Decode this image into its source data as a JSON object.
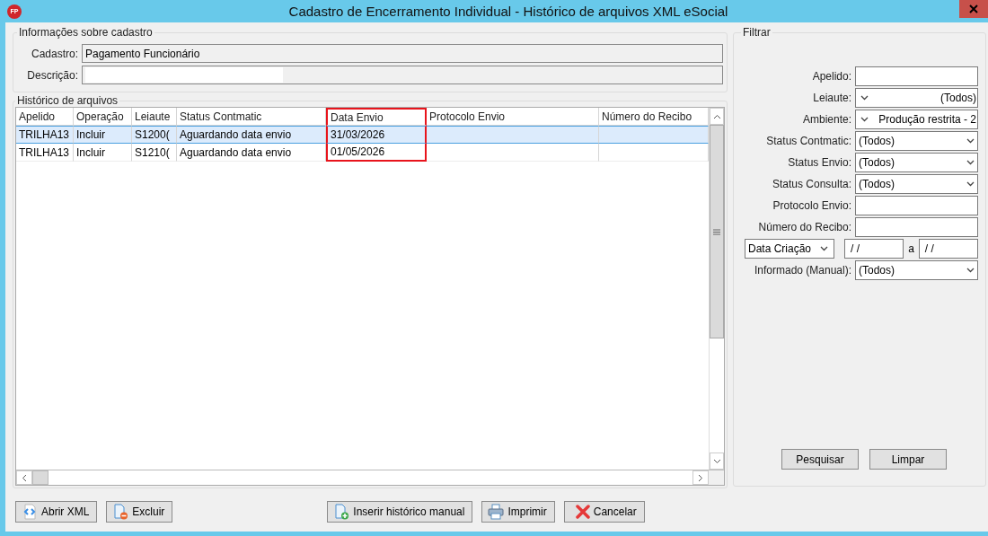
{
  "window": {
    "title": "Cadastro de Encerramento Individual - Histórico de arquivos XML eSocial",
    "app_icon_text": "FP"
  },
  "info": {
    "title": "Informações sobre cadastro",
    "fields": [
      {
        "label": "Cadastro:",
        "value": "Pagamento Funcionário"
      },
      {
        "label": "Descrição:",
        "masked": true
      }
    ]
  },
  "history": {
    "title": "Histórico de arquivos",
    "columns": [
      {
        "label": "Apelido",
        "highlighted": false
      },
      {
        "label": "Operação",
        "highlighted": false
      },
      {
        "label": "Leiaute",
        "highlighted": false
      },
      {
        "label": "Status Contmatic",
        "highlighted": false
      },
      {
        "label": "Data Envio",
        "highlighted": true
      },
      {
        "label": "Protocolo Envio",
        "highlighted": false
      },
      {
        "label": "Número do Recibo",
        "highlighted": false
      }
    ],
    "rows": [
      {
        "selected": true,
        "cells": [
          "TRILHA13",
          "Incluir",
          "S1200(",
          "Aguardando data envio",
          "31/03/2026",
          "",
          ""
        ]
      },
      {
        "selected": false,
        "cells": [
          "TRILHA13",
          "Incluir",
          "S1210(",
          "Aguardando data envio",
          "01/05/2026",
          "",
          ""
        ]
      }
    ]
  },
  "filter": {
    "title": "Filtrar",
    "fields": [
      {
        "kind": "text",
        "label": "Apelido:"
      },
      {
        "kind": "select-left",
        "label": "Leiaute:",
        "value": "(Todos)"
      },
      {
        "kind": "select-left",
        "label": "Ambiente:",
        "value": "Produção restrita - 2"
      },
      {
        "kind": "select",
        "label": "Status Contmatic:",
        "value": "(Todos)"
      },
      {
        "kind": "select",
        "label": "Status Envio:",
        "value": "(Todos)"
      },
      {
        "kind": "select",
        "label": "Status Consulta:",
        "value": "(Todos)"
      },
      {
        "kind": "text",
        "label": "Protocolo Envio:"
      },
      {
        "kind": "text",
        "label": "Número do Recibo:"
      },
      {
        "kind": "date-range",
        "label": "Data Criação",
        "from": "/ /",
        "separator": "a",
        "to": "/ /"
      },
      {
        "kind": "select",
        "label": "Informado (Manual):",
        "value": "(Todos)"
      }
    ],
    "buttons": [
      "Pesquisar",
      "Limpar"
    ]
  },
  "buttons": [
    {
      "kind": "xml",
      "label": "Abrir XML"
    },
    {
      "kind": "delete",
      "label": "Excluir"
    },
    {
      "kind": "add",
      "label": "Inserir histórico manual"
    },
    {
      "kind": "print",
      "label": "Imprimir"
    },
    {
      "kind": "cancel",
      "label": "Cancelar"
    }
  ]
}
